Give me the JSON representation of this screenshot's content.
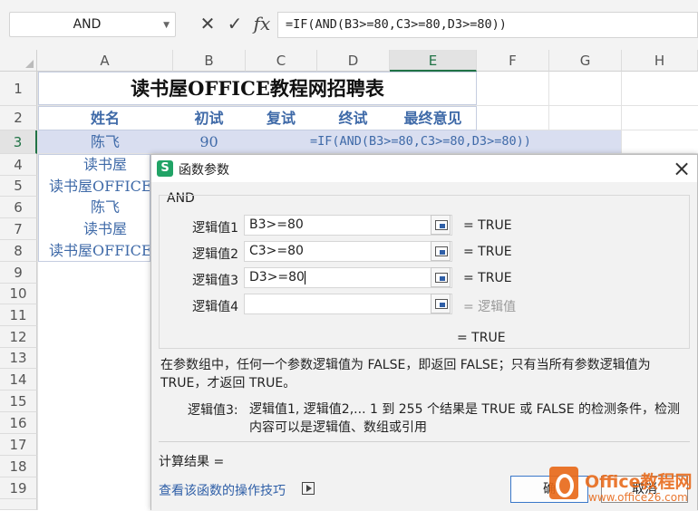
{
  "formula_bar": {
    "name_box": "AND",
    "cancel_icon": "✕",
    "enter_icon": "✓",
    "fx_icon": "fx",
    "formula": "=IF(AND(B3>=80,C3>=80,D3>=80))"
  },
  "columns": [
    "A",
    "B",
    "C",
    "D",
    "E",
    "F",
    "G",
    "H"
  ],
  "rows": [
    "1",
    "2",
    "3",
    "4",
    "5",
    "6",
    "7",
    "8",
    "9",
    "10",
    "11",
    "12",
    "13",
    "14",
    "15",
    "16",
    "17",
    "18",
    "19"
  ],
  "sheet": {
    "title": "读书屋OFFICE教程网招聘表",
    "headers": [
      "姓名",
      "初试",
      "复试",
      "终试",
      "最终意见"
    ],
    "row3": {
      "name": "陈飞",
      "score": "90",
      "formula": "=IF(AND(B3>=80,C3>=80,D3>=80))"
    },
    "names": [
      "读书屋",
      "读书屋OFFICE",
      "陈飞",
      "读书屋",
      "读书屋OFFICE"
    ]
  },
  "dialog": {
    "title": "函数参数",
    "close_icon": "×",
    "function_name": "AND",
    "args": [
      {
        "label": "逻辑值1",
        "value": "B3>=80",
        "result": "= TRUE"
      },
      {
        "label": "逻辑值2",
        "value": "C3>=80",
        "result": "= TRUE"
      },
      {
        "label": "逻辑值3",
        "value": "D3>=80",
        "result": "= TRUE"
      },
      {
        "label": "逻辑值4",
        "value": "",
        "result": "= 逻辑值"
      }
    ],
    "overall_result": "= TRUE",
    "description": "在参数组中，任何一个参数逻辑值为 FALSE，即返回 FALSE；只有当所有参数逻辑值为 TRUE，才返回 TRUE。",
    "param_name": "逻辑值3:",
    "param_desc": "逻辑值1, 逻辑值2,... 1 到 255 个结果是 TRUE 或 FALSE 的检测条件，检测内容可以是逻辑值、数组或引用",
    "calc_result": "计算结果 =",
    "help_link": "查看该函数的操作技巧",
    "ok_label": "确",
    "cancel_label": "取消"
  },
  "watermark": {
    "brand": "Office教程网",
    "url": "www.office26.com"
  },
  "colors": {
    "accent": "#3f6aa8",
    "selection": "#d9def0",
    "link": "#2f5fa7",
    "watermark": "#e86a1b"
  }
}
